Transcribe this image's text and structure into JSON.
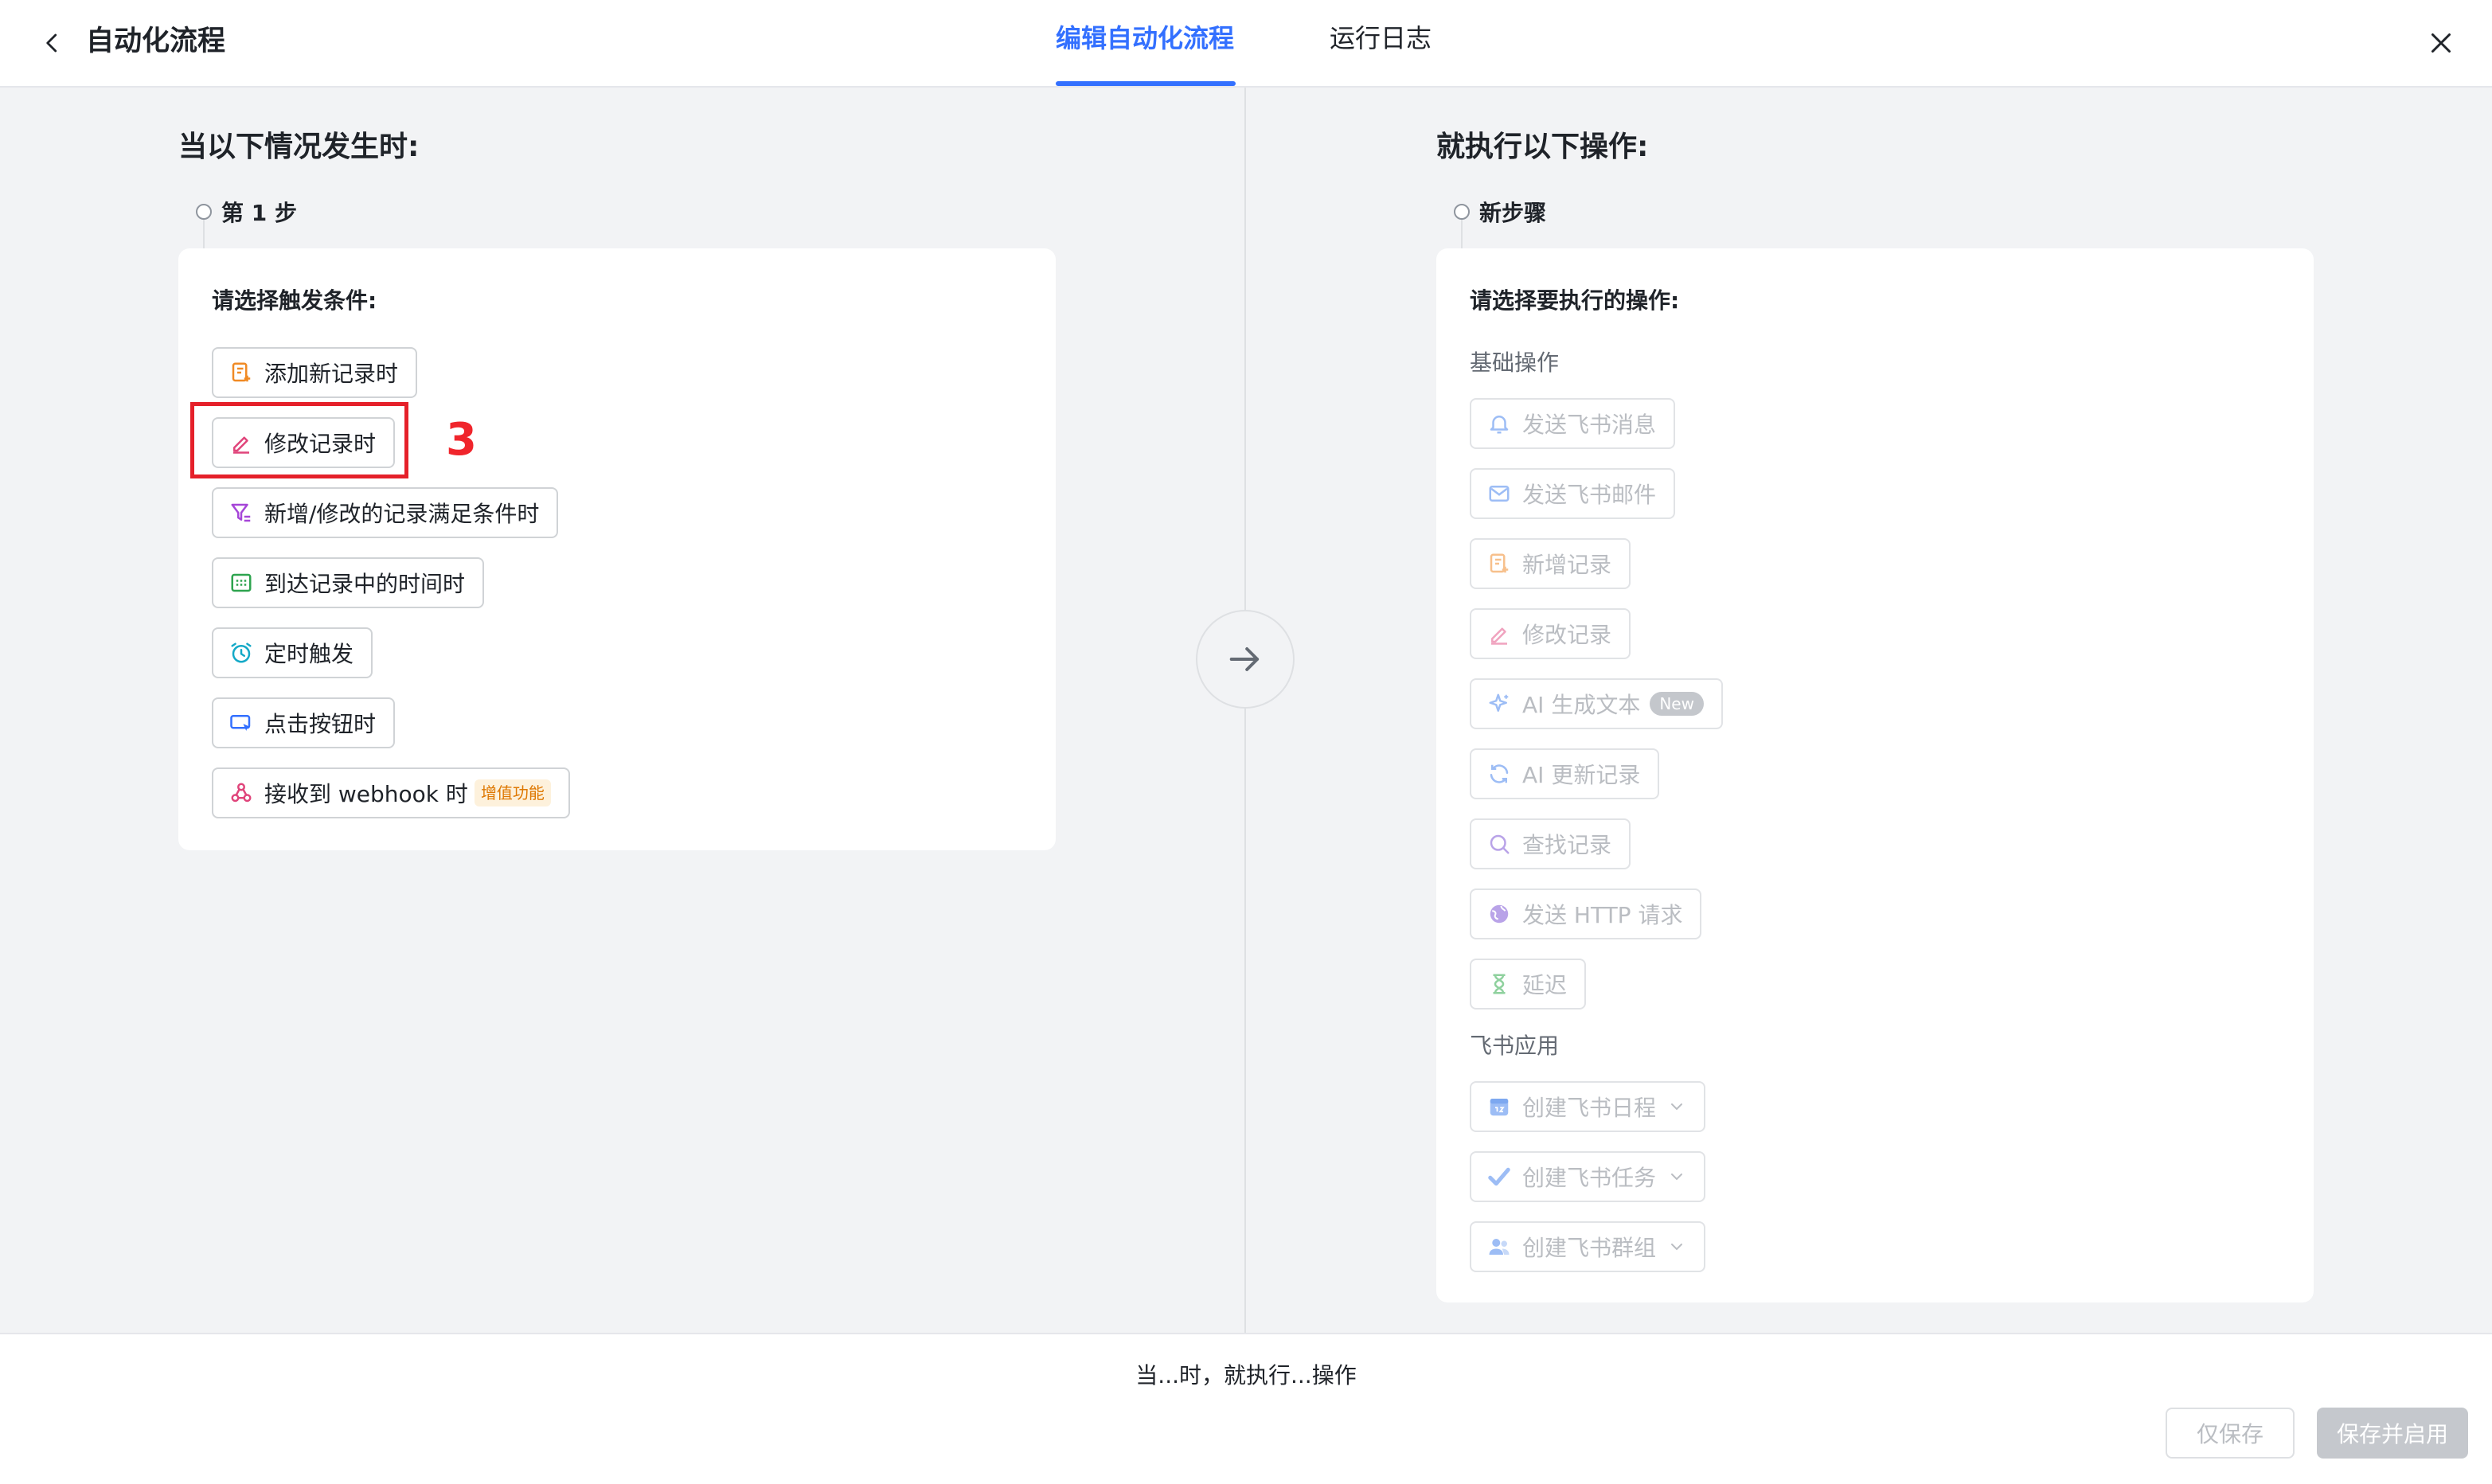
{
  "header": {
    "title": "自动化流程",
    "tabs": [
      {
        "label": "编辑自动化流程",
        "active": true
      },
      {
        "label": "运行日志",
        "active": false
      }
    ]
  },
  "trigger": {
    "section_title": "当以下情况发生时:",
    "step_label": "第 1 步",
    "prompt": "请选择触发条件:",
    "options": [
      {
        "label": "添加新记录时",
        "icon": "record-add-icon"
      },
      {
        "label": "修改记录时",
        "icon": "edit-pen-icon"
      },
      {
        "label": "新增/修改的记录满足条件时",
        "icon": "filter-icon"
      },
      {
        "label": "到达记录中的时间时",
        "icon": "calendar-grid-icon"
      },
      {
        "label": "定时触发",
        "icon": "alarm-clock-icon"
      },
      {
        "label": "点击按钮时",
        "icon": "click-button-icon"
      },
      {
        "label": "接收到 webhook 时",
        "icon": "webhook-icon",
        "badge": "增值功能"
      }
    ]
  },
  "annotation": {
    "number": "3"
  },
  "action": {
    "section_title": "就执行以下操作:",
    "step_label": "新步骤",
    "prompt": "请选择要执行的操作:",
    "groups": [
      {
        "label": "基础操作",
        "options": [
          {
            "label": "发送飞书消息",
            "icon": "bell-icon"
          },
          {
            "label": "发送飞书邮件",
            "icon": "mail-icon"
          },
          {
            "label": "新增记录",
            "icon": "record-add-icon"
          },
          {
            "label": "修改记录",
            "icon": "edit-pen-icon"
          },
          {
            "label": "AI 生成文本",
            "icon": "ai-sparkle-icon",
            "badge": "New"
          },
          {
            "label": "AI 更新记录",
            "icon": "refresh-icon"
          },
          {
            "label": "查找记录",
            "icon": "search-icon"
          },
          {
            "label": "发送 HTTP 请求",
            "icon": "globe-icon"
          },
          {
            "label": "延迟",
            "icon": "hourglass-icon"
          }
        ]
      },
      {
        "label": "飞书应用",
        "options": [
          {
            "label": "创建飞书日程",
            "icon": "calendar-icon"
          },
          {
            "label": "创建飞书任务",
            "icon": "task-check-icon"
          },
          {
            "label": "创建飞书群组",
            "icon": "group-icon"
          }
        ]
      }
    ]
  },
  "footer": {
    "summary": "当...时，就执行...操作",
    "save_only": "仅保存",
    "save_and_enable": "保存并启用"
  },
  "colors": {
    "accent": "#3370ff",
    "annotation_red": "#e5202a",
    "background": "#f2f3f5"
  }
}
